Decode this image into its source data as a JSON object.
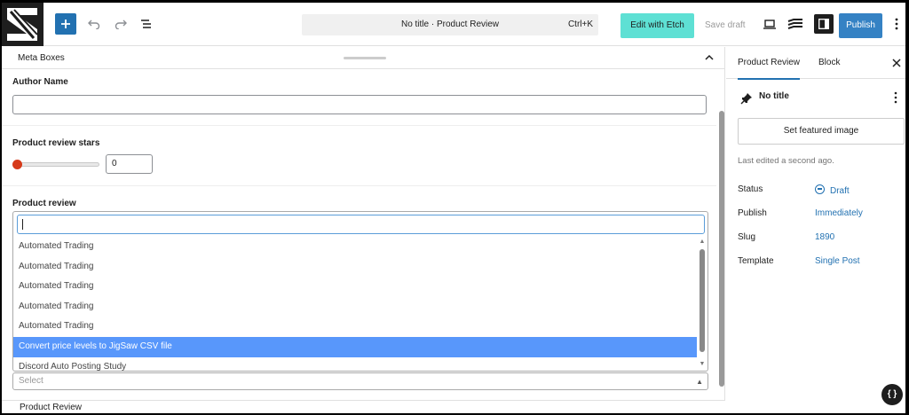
{
  "toolbar": {
    "command_title": "No title · Product Review",
    "command_shortcut": "Ctrl+K",
    "edit_with_etch": "Edit with Etch",
    "save_draft": "Save draft",
    "publish": "Publish"
  },
  "meta_boxes": {
    "title": "Meta Boxes",
    "author_name_label": "Author Name",
    "author_name_value": "",
    "stars_label": "Product review stars",
    "stars_value": "0",
    "review_label": "Product review",
    "review_search_value": "",
    "review_options": [
      "Automated Trading",
      "Automated Trading",
      "Automated Trading",
      "Automated Trading",
      "Automated Trading",
      "Convert price levels to JigSaw CSV file",
      "Discord Auto Posting Study"
    ],
    "highlighted_option_index": 5,
    "select_placeholder": "Select"
  },
  "bottom_bar": {
    "label": "Product Review"
  },
  "sidebar": {
    "tabs": [
      "Product Review",
      "Block"
    ],
    "active_tab": "Product Review",
    "post_title": "No title",
    "featured_image_button": "Set featured image",
    "last_edited": "Last edited a second ago.",
    "properties": [
      {
        "label": "Status",
        "value": "Draft"
      },
      {
        "label": "Publish",
        "value": "Immediately"
      },
      {
        "label": "Slug",
        "value": "1890"
      },
      {
        "label": "Template",
        "value": "Single Post"
      }
    ]
  },
  "floating": {
    "code_button": "{ }"
  },
  "colors": {
    "accent": "#2271b1",
    "etch_button": "#5ee0d4",
    "publish_button": "#3582c4",
    "slider_thumb": "#d63a1a",
    "highlight": "#5897fb"
  },
  "icons": {
    "add": "plus-icon",
    "undo": "undo-icon",
    "redo": "redo-icon",
    "document_overview": "list-view-icon",
    "view": "desktop-icon",
    "etch": "etch-logo-icon",
    "settings": "sidebar-toggle-icon",
    "more": "more-vertical-icon",
    "pin": "pin-icon",
    "close": "close-icon",
    "collapse": "chevron-up-icon"
  }
}
